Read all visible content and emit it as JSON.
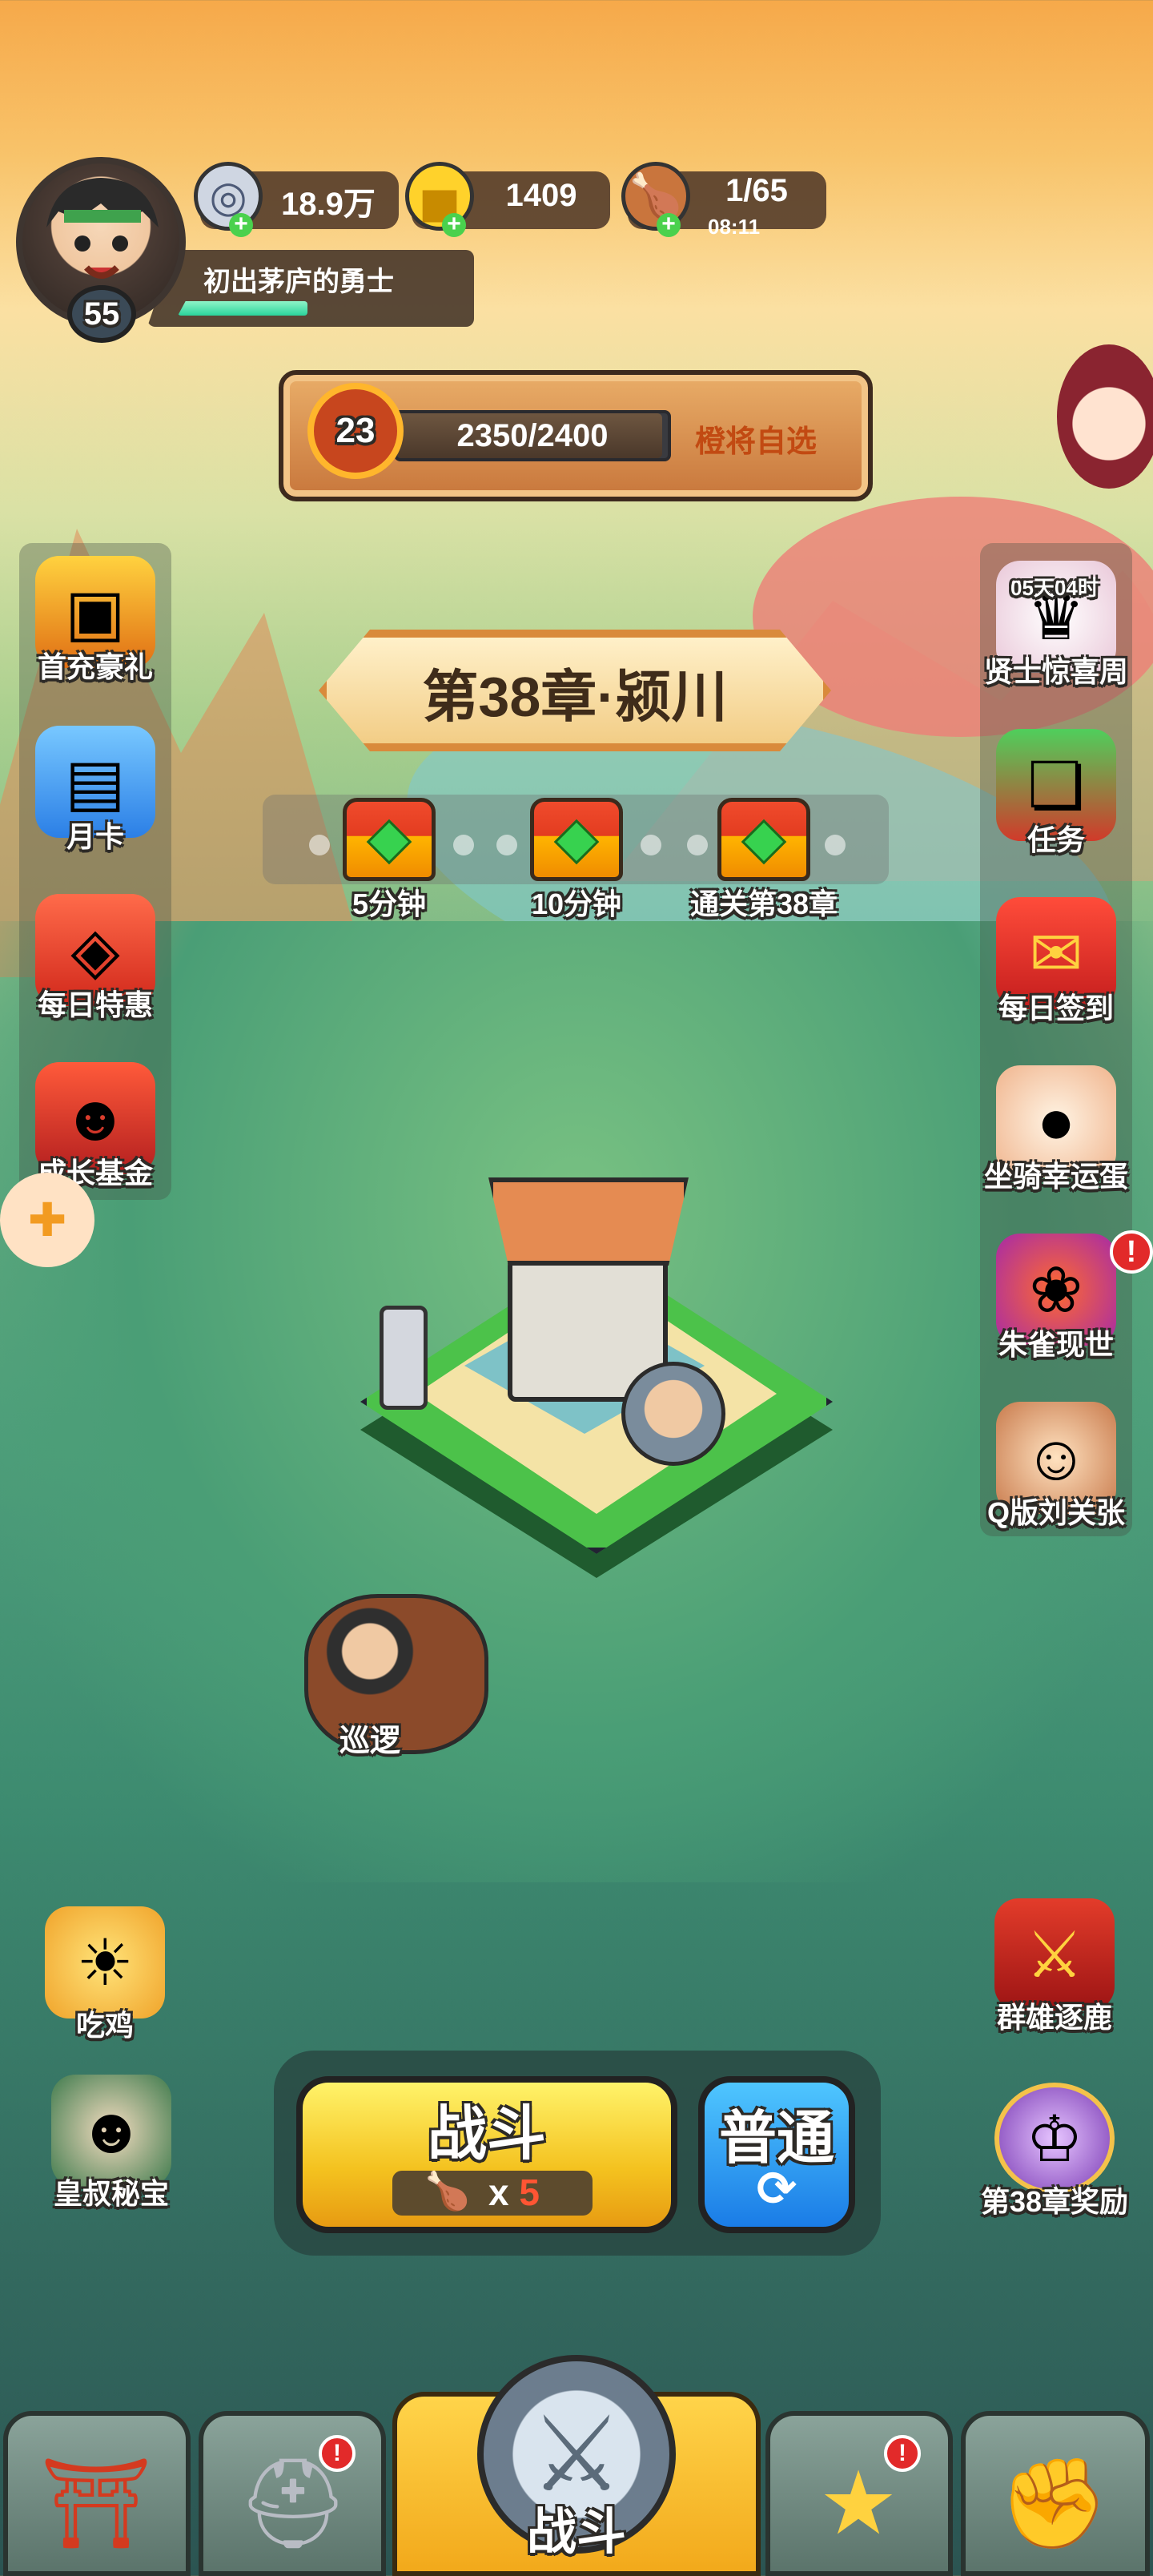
{
  "player": {
    "level": "55",
    "title": "初出茅庐的勇士"
  },
  "resources": {
    "silver": "18.9万",
    "gold": "1409",
    "stamina": "1/65",
    "stamina_timer": "08:11"
  },
  "rank": {
    "level": "23",
    "progress_text": "2350/2400",
    "progress_fraction": 0.979,
    "pick_label": "橙将自选"
  },
  "left_menu": [
    "首充豪礼",
    "月卡",
    "每日特惠",
    "成长基金"
  ],
  "right_menu": {
    "timer": "05天04时",
    "items": [
      "贤士惊喜周",
      "任务",
      "每日签到",
      "坐骑幸运蛋",
      "朱雀现世",
      "Q版刘关张"
    ]
  },
  "chapter": {
    "title": "第38章·颍川"
  },
  "chests": [
    {
      "label": "5分钟"
    },
    {
      "label": "10分钟"
    },
    {
      "label": "通关第38章"
    }
  ],
  "scene": {
    "patrol_label": "巡逻"
  },
  "left_bottom": [
    "吃鸡",
    "皇叔秘宝"
  ],
  "right_bottom": [
    "群雄逐鹿",
    "第38章奖励"
  ],
  "battle": {
    "fight_label": "战斗",
    "cost_multiplier": "x",
    "cost_value": "5",
    "mode_label": "普通"
  },
  "nav": {
    "center_label": "战斗"
  },
  "alerts": {
    "mark": "!"
  }
}
